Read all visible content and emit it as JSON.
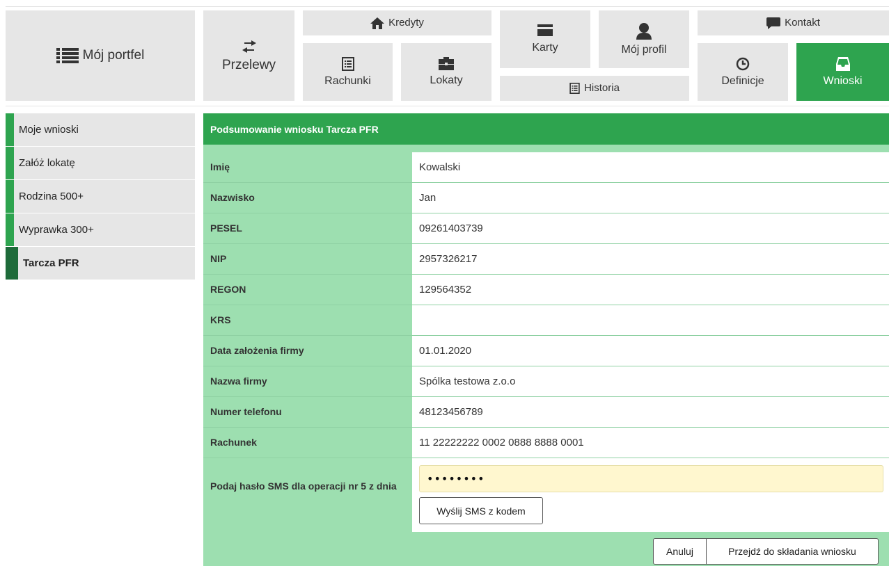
{
  "nav": {
    "portfel": "Mój portfel",
    "przelewy": "Przelewy",
    "kredyty": "Kredyty",
    "rachunki": "Rachunki",
    "lokaty": "Lokaty",
    "karty": "Karty",
    "profil": "Mój profil",
    "historia": "Historia",
    "kontakt": "Kontakt",
    "definicje": "Definicje",
    "wnioski": "Wnioski"
  },
  "sidebar": {
    "items": [
      {
        "label": "Moje wnioski"
      },
      {
        "label": "Załóż lokatę"
      },
      {
        "label": "Rodzina 500+"
      },
      {
        "label": "Wyprawka 300+"
      },
      {
        "label": "Tarcza PFR",
        "active": true
      }
    ]
  },
  "panel": {
    "title": "Podsumowanie wniosku Tarcza PFR",
    "fields": [
      {
        "label": "Imię",
        "value": "Kowalski"
      },
      {
        "label": "Nazwisko",
        "value": "Jan"
      },
      {
        "label": "PESEL",
        "value": "09261403739"
      },
      {
        "label": "NIP",
        "value": "2957326217"
      },
      {
        "label": "REGON",
        "value": "129564352"
      },
      {
        "label": "KRS",
        "value": ""
      },
      {
        "label": "Data założenia firmy",
        "value": "01.01.2020"
      },
      {
        "label": "Nazwa firmy",
        "value": "Spólka testowa z.o.o"
      },
      {
        "label": "Numer telefonu",
        "value": "48123456789"
      },
      {
        "label": "Rachunek",
        "value": "11 22222222 0002 0888 8888 0001"
      }
    ],
    "sms": {
      "label": "Podaj hasło SMS dla operacji nr 5 z dnia",
      "value": "••••••••",
      "send_label": "Wyślij SMS z kodem"
    },
    "cancel_label": "Anuluj",
    "next_label": "Przejdź do składania wniosku"
  },
  "colors": {
    "accent": "#2ea44f",
    "panel_bg": "#9ddfb0",
    "active_side": "#1e6b3a",
    "sms_bg": "#fff7cf"
  }
}
